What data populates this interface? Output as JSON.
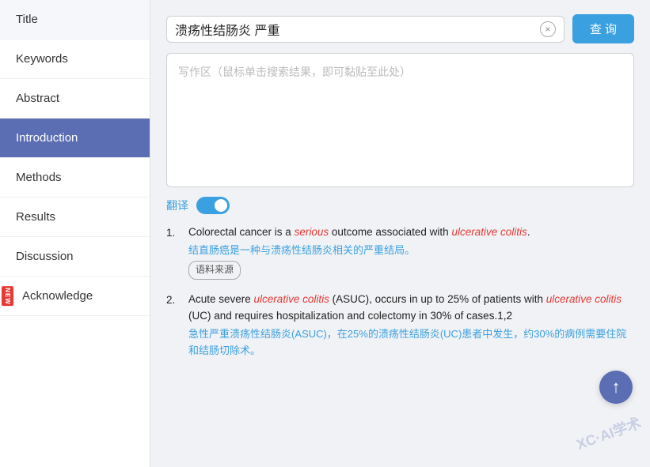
{
  "sidebar": {
    "items": [
      {
        "id": "title",
        "label": "Title",
        "active": false,
        "new": false
      },
      {
        "id": "keywords",
        "label": "Keywords",
        "active": false,
        "new": false
      },
      {
        "id": "abstract",
        "label": "Abstract",
        "active": false,
        "new": false
      },
      {
        "id": "introduction",
        "label": "Introduction",
        "active": true,
        "new": false
      },
      {
        "id": "methods",
        "label": "Methods",
        "active": false,
        "new": false
      },
      {
        "id": "results",
        "label": "Results",
        "active": false,
        "new": false
      },
      {
        "id": "discussion",
        "label": "Discussion",
        "active": false,
        "new": false
      },
      {
        "id": "acknowledge",
        "label": "Acknowledge",
        "active": false,
        "new": true
      }
    ]
  },
  "search": {
    "query": "溃疡性结肠炎 严重",
    "placeholder": "溃疡性结肠炎 严重",
    "clear_label": "×",
    "search_label": "查 询"
  },
  "writing_area": {
    "placeholder": "写作区（鼠标单击搜索结果，即可黏贴至此处）"
  },
  "translate": {
    "label": "翻译",
    "enabled": true
  },
  "results": [
    {
      "number": "1.",
      "en_html": "Colorectal cancer is a <em class='italic-red'>serious</em> outcome associated with <em class='italic-red'>ulcerative colitis</em>.",
      "zh_html": "结直肠癌是一种与<em class='link-blue'>溃疡性结肠炎</em>相关的<em class='link-blue'>严重</em>结局。",
      "source_tag": "语料来源"
    },
    {
      "number": "2.",
      "en_html": "Acute severe <em class='italic-red'>ulcerative colitis</em> (ASUC), occurs in up to 25% of patients with <em class='italic-red'>ulcerative colitis</em> (UC) and requires hospitalization and colectomy in 30% of cases.1,2",
      "zh_html": "急性<em class='link-blue'>严重溃疡性结肠炎</em>(ASUC)，在25%的<em class='link-blue'>溃疡性结肠炎</em>(UC)患者中发生，约30%的病例需要住院和<em class='link-blue'>结肠切</em>除术。",
      "source_tag": null
    }
  ],
  "watermark": "XC·AI学术",
  "scroll_top": "↑",
  "new_badge_text": "NEW"
}
